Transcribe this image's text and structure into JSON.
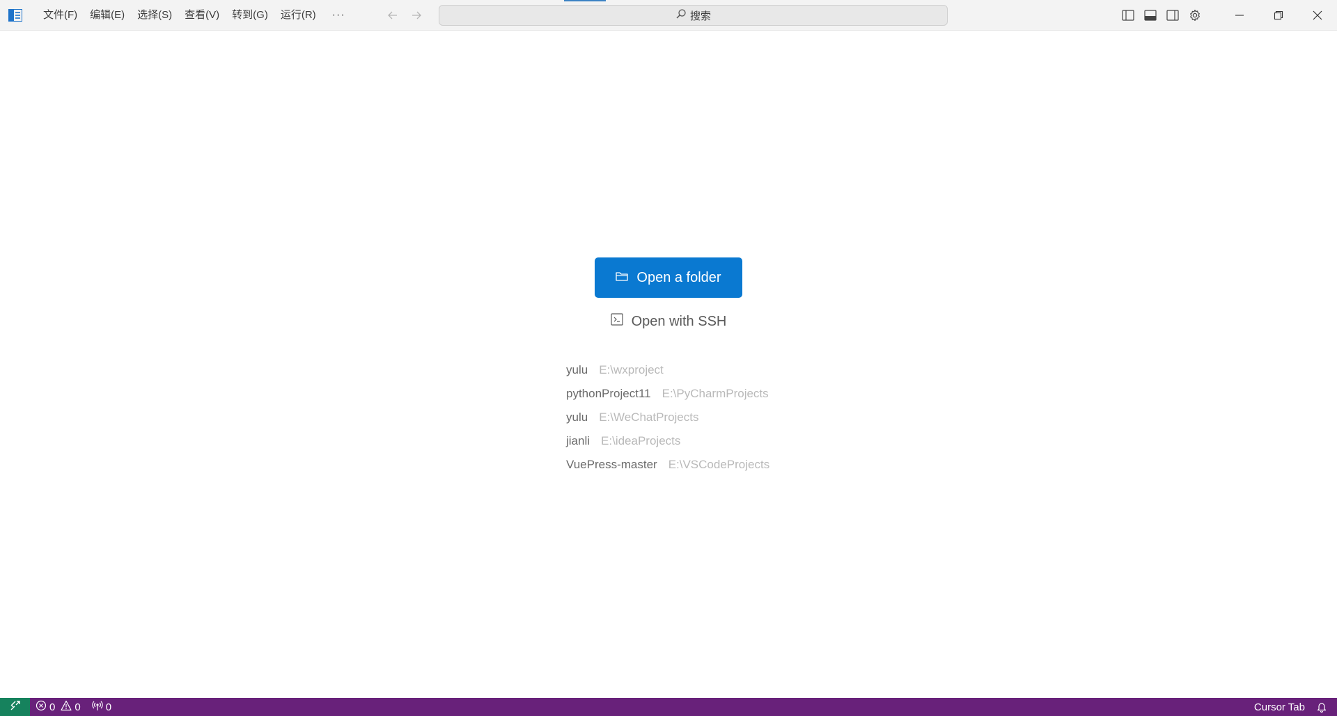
{
  "titlebar": {
    "menu": [
      "文件(F)",
      "编辑(E)",
      "选择(S)",
      "查看(V)",
      "转到(G)",
      "运行(R)"
    ],
    "more": "···",
    "search_label": "搜索"
  },
  "main": {
    "open_folder_label": "Open a folder",
    "open_ssh_label": "Open with SSH",
    "recent": [
      {
        "name": "yulu",
        "path": "E:\\wxproject"
      },
      {
        "name": "pythonProject11",
        "path": "E:\\PyCharmProjects"
      },
      {
        "name": "yulu",
        "path": "E:\\WeChatProjects"
      },
      {
        "name": "jianli",
        "path": "E:\\ideaProjects"
      },
      {
        "name": "VuePress-master",
        "path": "E:\\VSCodeProjects"
      }
    ]
  },
  "statusbar": {
    "errors": "0",
    "warnings": "0",
    "ports": "0",
    "cursor_tab": "Cursor Tab"
  },
  "colors": {
    "accent": "#0a79d1",
    "statusbar": "#68217a",
    "remote": "#16825d"
  }
}
